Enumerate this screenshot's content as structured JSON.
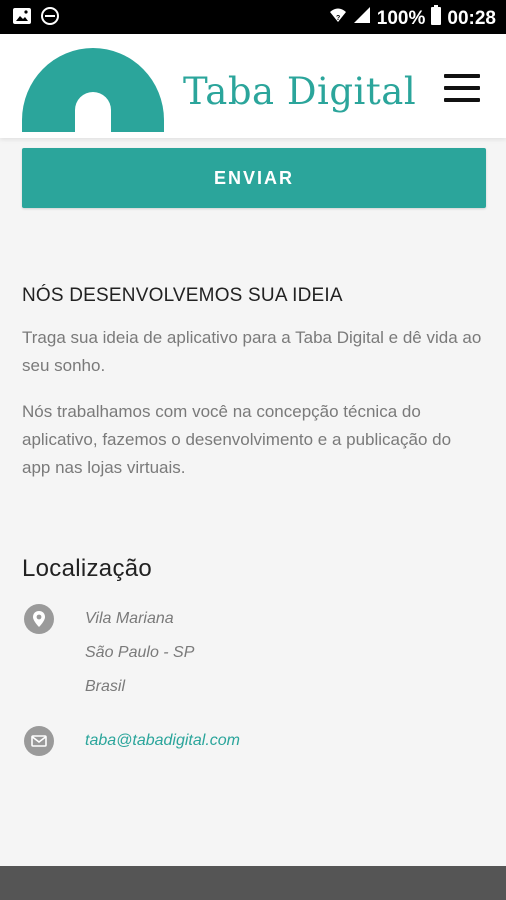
{
  "status_bar": {
    "battery": "100%",
    "time": "00:28",
    "icons": [
      "image-icon",
      "do-not-disturb-icon",
      "wifi-icon",
      "signal-icon",
      "battery-icon"
    ]
  },
  "header": {
    "brand": "Taba Digital",
    "accent_color": "#2ba59b",
    "menu_icon": "hamburger-menu-icon"
  },
  "form": {
    "send_label": "ENVIAR"
  },
  "about": {
    "title": "NÓS DESENVOLVEMOS SUA IDEIA",
    "paragraph1": "Traga sua ideia de aplicativo para a Taba Digital e dê vida ao seu sonho.",
    "paragraph2": "Nós trabalhamos com você na concepção técnica do aplicativo, fazemos o desenvolvimento e a publicação do app nas lojas virtuais."
  },
  "location": {
    "title": "Localização",
    "address": [
      "Vila Mariana",
      "São Paulo - SP",
      "Brasil"
    ],
    "email": "taba@tabadigital.com",
    "icons": [
      "map-pin-icon",
      "envelope-icon"
    ]
  }
}
